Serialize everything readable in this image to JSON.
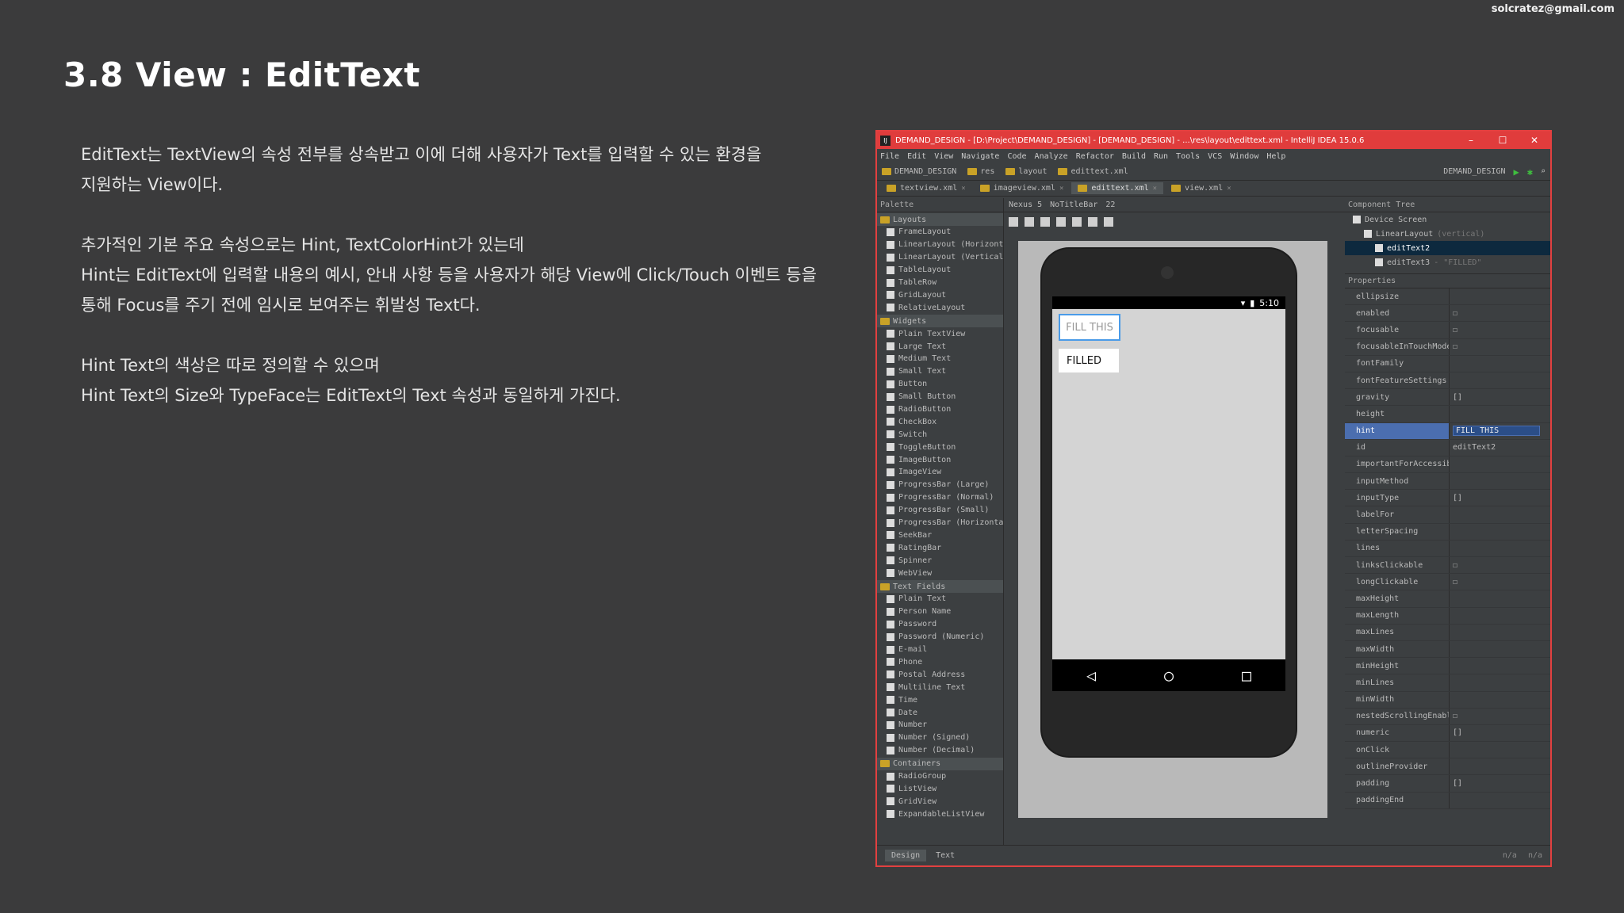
{
  "slide": {
    "email": "solcratez@gmail.com",
    "title": "3.8 View : EditText",
    "paragraphs": [
      [
        "EditText는 TextView의 속성 전부를 상속받고 이에 더해 사용자가 Text를 입력할 수 있는 환경을",
        "지원하는 View이다."
      ],
      [
        "추가적인 기본 주요 속성으로는 Hint, TextColorHint가 있는데",
        "Hint는 EditText에 입력할 내용의 예시, 안내 사항 등을 사용자가 해당 View에 Click/Touch 이벤트 등을",
        "통해 Focus를 주기 전에 임시로 보여주는 휘발성 Text다."
      ],
      [
        "Hint Text의 색상은 따로 정의할 수 있으며",
        "Hint Text의 Size와 TypeFace는 EditText의 Text 속성과 동일하게 가진다."
      ]
    ]
  },
  "ide": {
    "window_title": "DEMAND_DESIGN - [D:\\Project\\DEMAND_DESIGN] - [DEMAND_DESIGN] - ...\\res\\layout\\edittext.xml - IntelliJ IDEA 15.0.6",
    "app_icon": "IJ",
    "menu": [
      "File",
      "Edit",
      "View",
      "Navigate",
      "Code",
      "Analyze",
      "Refactor",
      "Build",
      "Run",
      "Tools",
      "VCS",
      "Window",
      "Help"
    ],
    "breadcrumbs": [
      "DEMAND_DESIGN",
      "res",
      "layout",
      "edittext.xml"
    ],
    "run_config": "DEMAND_DESIGN",
    "tabs": [
      {
        "label": "textview.xml",
        "active": false
      },
      {
        "label": "imageview.xml",
        "active": false
      },
      {
        "label": "edittext.xml",
        "active": true
      },
      {
        "label": "view.xml",
        "active": false
      }
    ],
    "palette": {
      "title": "Palette",
      "categories": [
        {
          "name": "Layouts",
          "items": [
            "FrameLayout",
            "LinearLayout (Horizont",
            "LinearLayout (Vertical",
            "TableLayout",
            "TableRow",
            "GridLayout",
            "RelativeLayout"
          ]
        },
        {
          "name": "Widgets",
          "items": [
            "Plain TextView",
            "Large Text",
            "Medium Text",
            "Small Text",
            "Button",
            "Small Button",
            "RadioButton",
            "CheckBox",
            "Switch",
            "ToggleButton",
            "ImageButton",
            "ImageView",
            "ProgressBar (Large)",
            "ProgressBar (Normal)",
            "ProgressBar (Small)",
            "ProgressBar (Horizonta",
            "SeekBar",
            "RatingBar",
            "Spinner",
            "WebView"
          ]
        },
        {
          "name": "Text Fields",
          "items": [
            "Plain Text",
            "Person Name",
            "Password",
            "Password (Numeric)",
            "E-mail",
            "Phone",
            "Postal Address",
            "Multiline Text",
            "Time",
            "Date",
            "Number",
            "Number (Signed)",
            "Number (Decimal)"
          ]
        },
        {
          "name": "Containers",
          "items": [
            "RadioGroup",
            "ListView",
            "GridView",
            "ExpandableListView"
          ]
        }
      ]
    },
    "designer": {
      "device": "Nexus 5",
      "theme": "NoTitleBar",
      "api": "22",
      "status_time": "5:10",
      "edit1_hint": "FILL THIS",
      "edit2_text": "FILLED"
    },
    "component_tree": {
      "title": "Component Tree",
      "rows": [
        {
          "label": "Device Screen",
          "hint": "",
          "selected": false,
          "depth": 0
        },
        {
          "label": "LinearLayout",
          "hint": "(vertical)",
          "selected": false,
          "depth": 1
        },
        {
          "label": "editText2",
          "hint": "",
          "selected": true,
          "depth": 2
        },
        {
          "label": "editText3",
          "hint": "- \"FILLED\"",
          "selected": false,
          "depth": 2
        }
      ]
    },
    "properties": {
      "title": "Properties",
      "rows": [
        {
          "name": "ellipsize",
          "value": ""
        },
        {
          "name": "enabled",
          "value": "☐"
        },
        {
          "name": "focusable",
          "value": "☐"
        },
        {
          "name": "focusableInTouchMode",
          "value": "☐"
        },
        {
          "name": "fontFamily",
          "value": ""
        },
        {
          "name": "fontFeatureSettings",
          "value": ""
        },
        {
          "name": "gravity",
          "value": "[]"
        },
        {
          "name": "height",
          "value": ""
        },
        {
          "name": "hint",
          "value": "FILL THIS",
          "selected": true
        },
        {
          "name": "id",
          "value": "editText2"
        },
        {
          "name": "importantForAccessibil",
          "value": ""
        },
        {
          "name": "inputMethod",
          "value": ""
        },
        {
          "name": "inputType",
          "value": "[]"
        },
        {
          "name": "labelFor",
          "value": ""
        },
        {
          "name": "letterSpacing",
          "value": ""
        },
        {
          "name": "lines",
          "value": ""
        },
        {
          "name": "linksClickable",
          "value": "☐"
        },
        {
          "name": "longClickable",
          "value": "☐"
        },
        {
          "name": "maxHeight",
          "value": ""
        },
        {
          "name": "maxLength",
          "value": ""
        },
        {
          "name": "maxLines",
          "value": ""
        },
        {
          "name": "maxWidth",
          "value": ""
        },
        {
          "name": "minHeight",
          "value": ""
        },
        {
          "name": "minLines",
          "value": ""
        },
        {
          "name": "minWidth",
          "value": ""
        },
        {
          "name": "nestedScrollingEnabled",
          "value": "☐"
        },
        {
          "name": "numeric",
          "value": "[]"
        },
        {
          "name": "onClick",
          "value": ""
        },
        {
          "name": "outlineProvider",
          "value": ""
        },
        {
          "name": "padding",
          "value": "[]"
        },
        {
          "name": "paddingEnd",
          "value": ""
        }
      ]
    },
    "bottom_tabs": [
      "Design",
      "Text"
    ],
    "status_right": [
      "n/a",
      "n/a"
    ]
  }
}
